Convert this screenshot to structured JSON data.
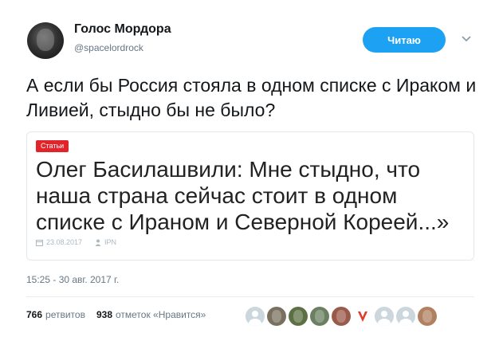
{
  "user": {
    "name": "Голос Мордора",
    "handle": "@spacelordrock"
  },
  "follow_button": {
    "label": "Читаю"
  },
  "tweet": {
    "text": "А если бы Россия стояла в одном списке с Ираком и Ливией, стыдно бы не было?"
  },
  "card": {
    "tag": "Статьи",
    "title": "Олег Басилашвили: Мне стыдно, что наша страна сейчас стоит в одном списке с Ираном и Северной Кореей...»",
    "date": "23.08.2017",
    "source": "IPN"
  },
  "timestamp": "15:25 - 30 авг. 2017 г.",
  "stats": {
    "retweets_count": "766",
    "retweets_label": "ретвитов",
    "likes_count": "938",
    "likes_label": "отметок «Нравится»"
  },
  "likers": [
    {
      "avatar": "default-avatar",
      "color": "#ccd6dd"
    },
    {
      "avatar": "photo-avatar",
      "color": "#7a7060"
    },
    {
      "avatar": "photo-avatar",
      "color": "#5d7043"
    },
    {
      "avatar": "photo-avatar",
      "color": "#6b8060"
    },
    {
      "avatar": "photo-avatar",
      "color": "#9a5a4a"
    },
    {
      "avatar": "v-logo-avatar",
      "color": "#e03a2a"
    },
    {
      "avatar": "default-avatar",
      "color": "#ccd6dd"
    },
    {
      "avatar": "default-avatar",
      "color": "#ccd6dd"
    },
    {
      "avatar": "photo-avatar",
      "color": "#b08060"
    }
  ],
  "colors": {
    "accent": "#1da1f2",
    "tag": "#e0242a",
    "muted": "#657786"
  }
}
